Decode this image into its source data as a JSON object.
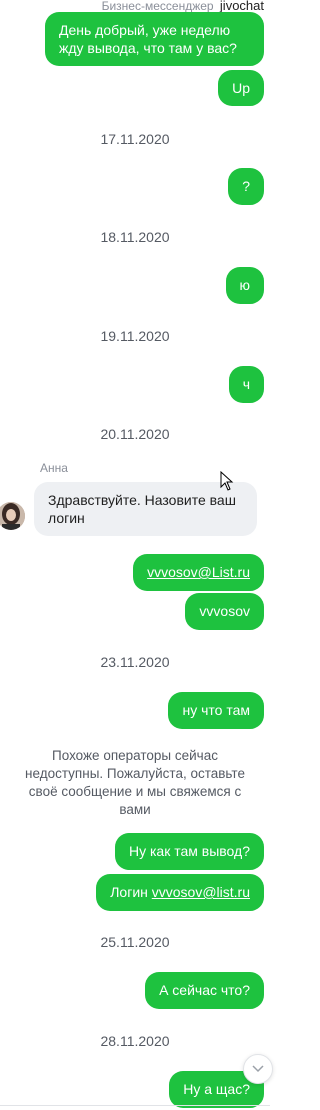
{
  "header": {
    "brand_text": "Бизнес-мессенджер",
    "logo_text": "jivochat"
  },
  "messages": {
    "m1": "День добрый, уже неделю жду вывода, что там у вас?",
    "m2": "Up",
    "m3": "?",
    "m4": "ю",
    "m5": "ч",
    "m6": "vvvosov@List.ru",
    "m7": "vvvosov",
    "m8": "ну что там",
    "m9": "Ну как там вывод?",
    "m10_prefix": "Логин ",
    "m10_link": "vvvosov@list.ru",
    "m11": "А сейчас что?",
    "m12": "Ну а щас?"
  },
  "dates": {
    "d1": "17.11.2020",
    "d2": "18.11.2020",
    "d3": "19.11.2020",
    "d4": "20.11.2020",
    "d5": "23.11.2020",
    "d6": "25.11.2020",
    "d7": "28.11.2020"
  },
  "operator": {
    "name": "Анна",
    "message": "Здравствуйте. Назовите ваш логин"
  },
  "system": {
    "offline_notice": "Похоже операторы сейчас недоступны. Пожалуйста, оставьте своё сообщение и мы свяжемся с вами"
  },
  "icons": {
    "scroll_down": "chevron-down-icon",
    "cursor": "mouse-pointer-icon"
  },
  "colors": {
    "outgoing_bubble": "#1ec23f",
    "incoming_bubble": "#eef0f3"
  }
}
